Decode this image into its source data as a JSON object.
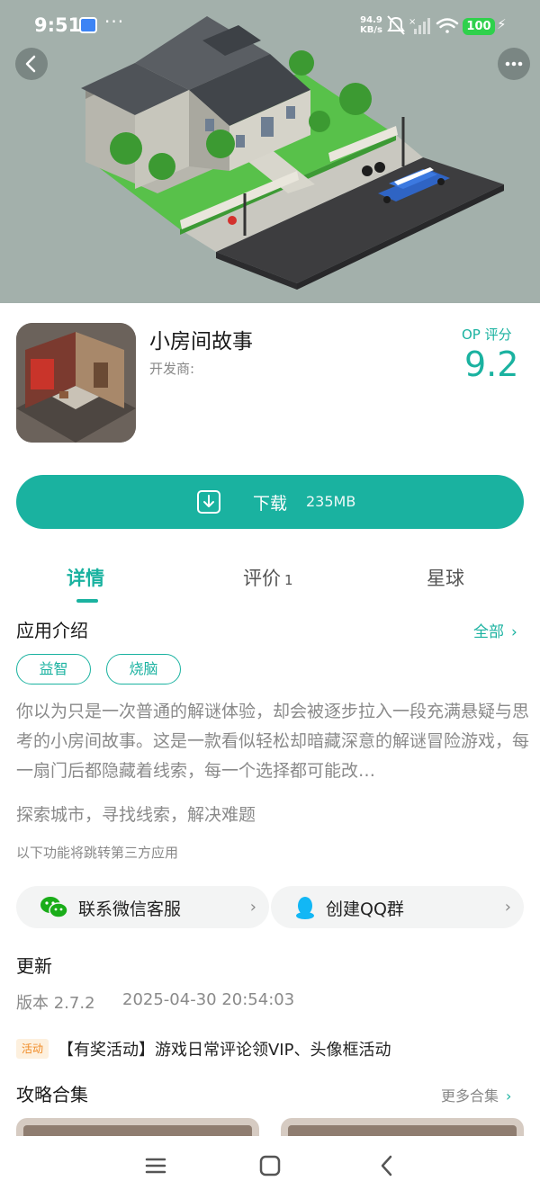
{
  "status_bar": {
    "time": "9:51",
    "more": "···",
    "speed_value": "94.9",
    "speed_unit": "KB/s",
    "battery": "100"
  },
  "app": {
    "title": "小房间故事",
    "developer_label": "开发商:",
    "rating_label": "OP 评分",
    "rating_value": "9.2"
  },
  "download": {
    "label": "下载",
    "size": "235MB"
  },
  "tabs": {
    "details": "详情",
    "reviews": "评价",
    "reviews_count": "1",
    "planet": "星球"
  },
  "intro": {
    "title": "应用介绍",
    "see_all": "全部",
    "tags": [
      "益智",
      "烧脑"
    ],
    "description": "你以为只是一次普通的解谜体验，却会被逐步拉入一段充满悬疑与思考的小房间故事。这是一款看似轻松却暗藏深意的解谜冒险游戏，每一扇门后都隐藏着线索，每一个选择都可能改…",
    "subtitle": "探索城市，寻找线索，解决难题",
    "third_party_note": "以下功能将跳转第三方应用"
  },
  "contact": {
    "wechat": "联系微信客服",
    "qq": "创建QQ群"
  },
  "update": {
    "title": "更新",
    "version": "版本 2.7.2",
    "time": "2025-04-30 20:54:03",
    "activity_badge": "活动",
    "activity_text": "【有奖活动】游戏日常评论领VIP、头像框活动"
  },
  "guides": {
    "title": "攻略合集",
    "more": "更多合集"
  },
  "colors": {
    "accent": "#1ab2a0",
    "activity": "#f08a24",
    "battery": "#2fd14c"
  }
}
